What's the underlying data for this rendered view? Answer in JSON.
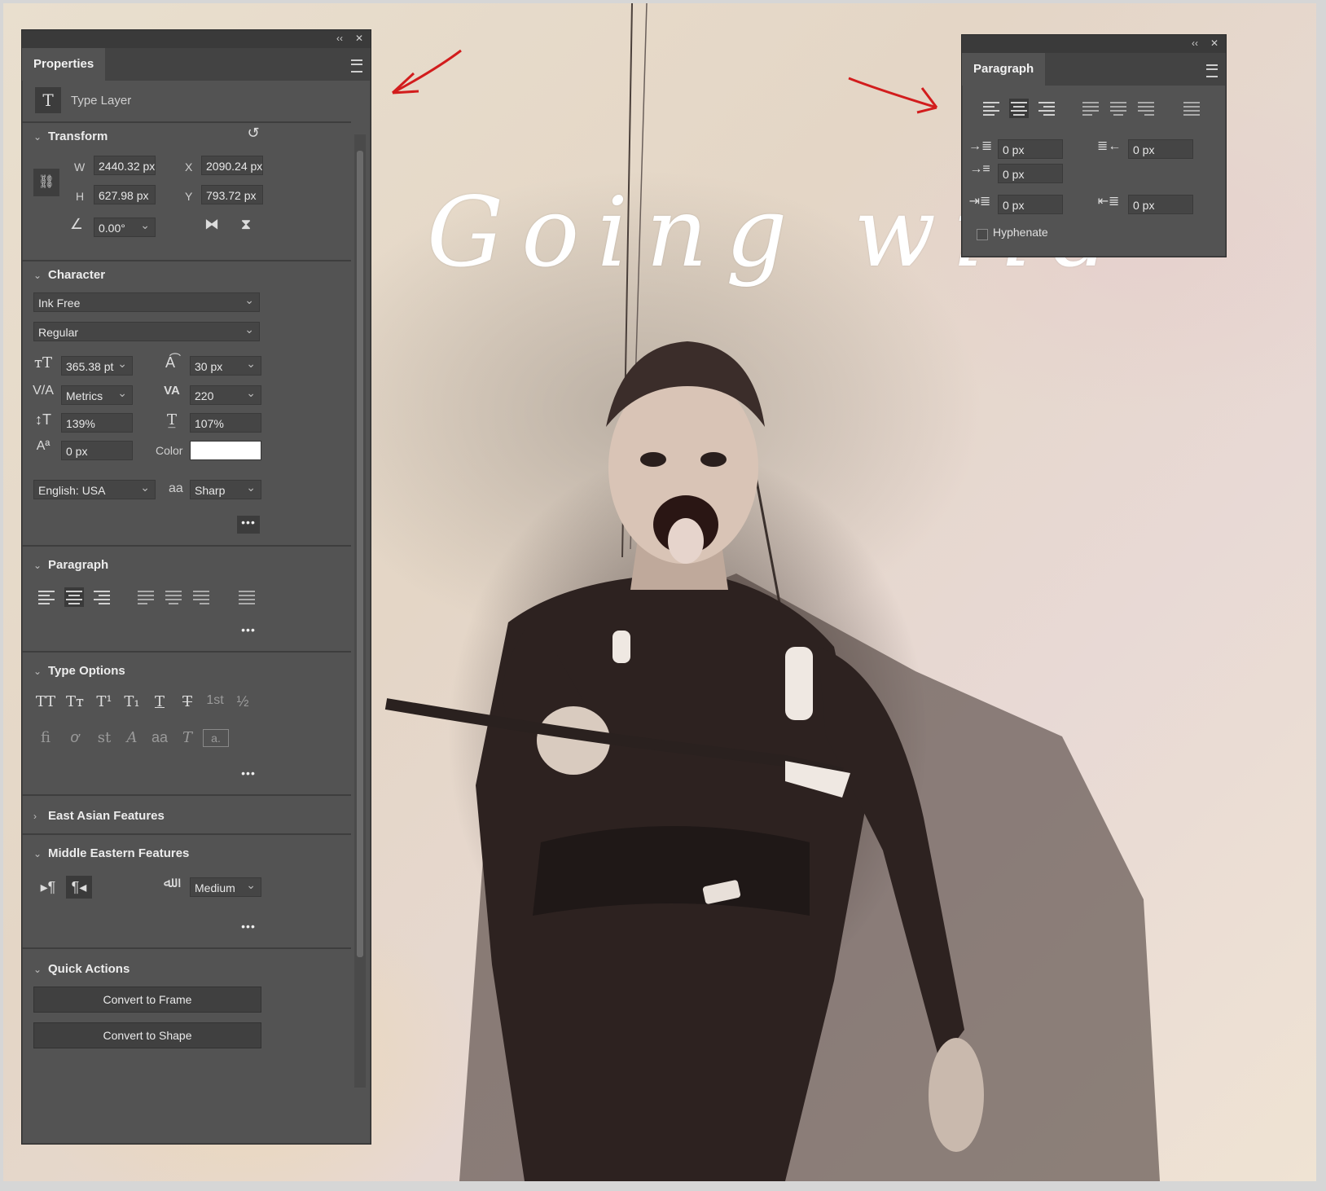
{
  "canvas": {
    "title_text": "Going wild"
  },
  "properties": {
    "tab": "Properties",
    "layer_type": "Type Layer",
    "transform": {
      "heading": "Transform",
      "w_label": "W",
      "w": "2440.32 px",
      "h_label": "H",
      "h": "627.98 px",
      "x_label": "X",
      "x": "2090.24 px",
      "y_label": "Y",
      "y": "793.72 px",
      "angle": "0.00°"
    },
    "character": {
      "heading": "Character",
      "font": "Ink Free",
      "style": "Regular",
      "size": "365.38 pt",
      "leading": "30 px",
      "kerning": "Metrics",
      "tracking": "220",
      "vscale": "139%",
      "hscale": "107%",
      "baseline": "0 px",
      "color_label": "Color",
      "color": "#ffffff",
      "language": "English: USA",
      "antialias_icon": "aa",
      "antialias": "Sharp",
      "more": "•••"
    },
    "paragraph": {
      "heading": "Paragraph",
      "more": "•••"
    },
    "type_options": {
      "heading": "Type Options",
      "row1": [
        "TT",
        "Tт",
        "T¹",
        "T₁",
        "T",
        "T",
        "1st",
        "½"
      ],
      "row2": [
        "fi",
        "ơ",
        "st",
        "A",
        "aa",
        "T",
        "a."
      ],
      "more": "•••"
    },
    "east_asian": {
      "heading": "East Asian Features"
    },
    "middle_eastern": {
      "heading": "Middle Eastern Features",
      "justify": "Medium",
      "more": "•••"
    },
    "quick_actions": {
      "heading": "Quick Actions",
      "convert_frame": "Convert to Frame",
      "convert_shape": "Convert to Shape"
    }
  },
  "paragraph_panel": {
    "tab": "Paragraph",
    "indent_left": "0 px",
    "indent_right": "0 px",
    "indent_first": "0 px",
    "space_before": "0 px",
    "space_after": "0 px",
    "hyphenate": "Hyphenate"
  },
  "topbar": {
    "collapse": "‹‹",
    "close": "✕"
  }
}
